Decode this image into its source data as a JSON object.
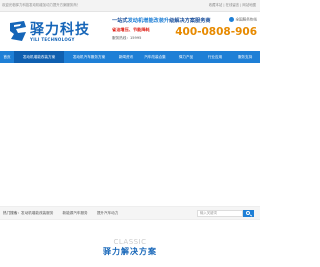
{
  "topbar": {
    "welcome": "欢迎光临驿力科技发动机增加动力提升方案服务商！",
    "links": "收藏本站 | 在线留言 | 网站地图"
  },
  "logo": {
    "cn": "驿力科技",
    "en": "YILI TECHNOLOGY",
    "color": "#1565b8"
  },
  "slogan": {
    "prefix": "一站式",
    "highlight": "发动机增能改装升",
    "suffix": "级解决方案服务商",
    "sub1": "省油增压、节能降耗",
    "sub2": "",
    "service": "服务热线：15995"
  },
  "hotline": {
    "label": "全国服务热线",
    "number": "400-0808-906",
    "color": "#e78a00"
  },
  "nav": {
    "items": [
      {
        "label": "首页"
      },
      {
        "label": "发动机增能改装方案"
      },
      {
        "label": "发动机汽车服务方案"
      },
      {
        "label": "新闻资讯"
      },
      {
        "label": "汽车改装合集"
      },
      {
        "label": "驿力产品"
      },
      {
        "label": "行业应用"
      },
      {
        "label": "服务支持"
      }
    ],
    "active_index": 1,
    "color": "#1e7fd6"
  },
  "crumb": {
    "label": "热门搜索：",
    "links": [
      "发动机增能改装服务",
      "新能源汽车服务",
      "提升汽车动力"
    ],
    "search_placeholder": "输入关键词"
  },
  "section": {
    "en": "CLASSIC",
    "cn": "驿力解决方案"
  }
}
